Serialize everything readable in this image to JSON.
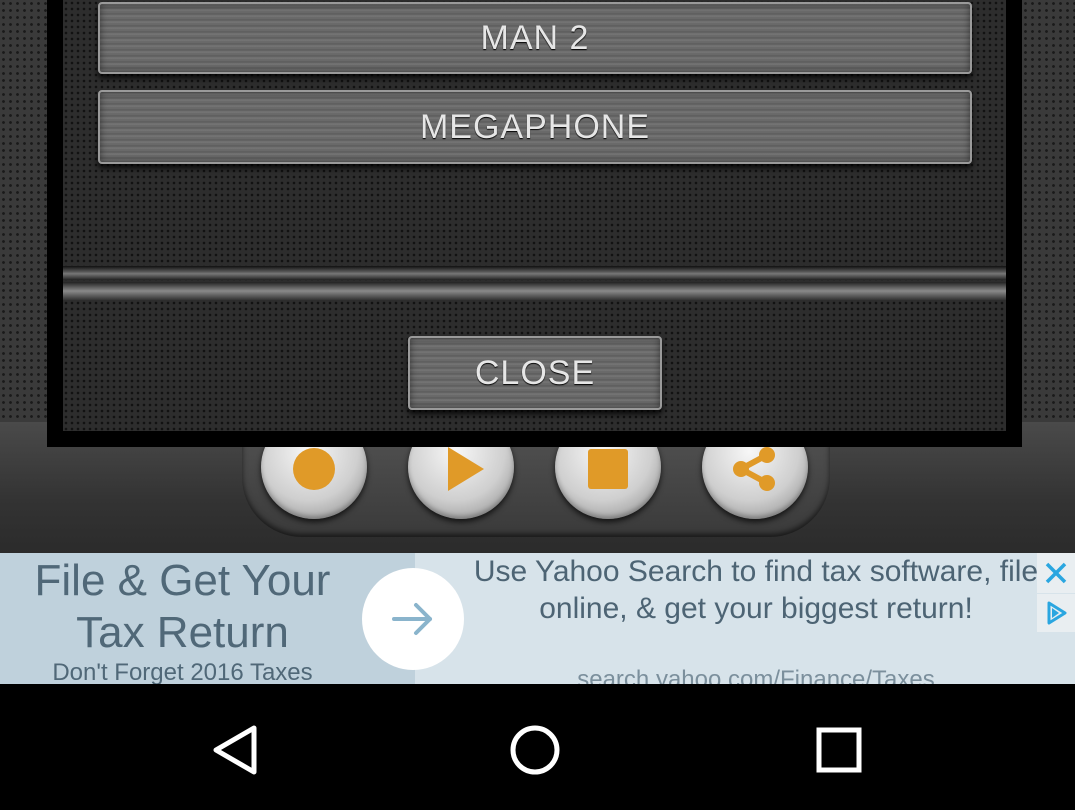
{
  "dialog": {
    "options": [
      {
        "label": "MAN 2"
      },
      {
        "label": "MEGAPHONE"
      }
    ],
    "close_label": "CLOSE"
  },
  "controls": {
    "record": "record-icon",
    "play": "play-icon",
    "stop": "stop-icon",
    "share": "share-icon",
    "accent_color": "#e09a28"
  },
  "ad": {
    "headline": "File & Get Your Tax Return",
    "subline": "Don't Forget 2016 Taxes",
    "body": "Use Yahoo Search to find tax software, file online, & get your biggest return!",
    "url": "search.yahoo.com/Finance/Taxes",
    "close_icon": "close-icon",
    "adchoices_icon": "adchoices-icon",
    "accent_color": "#2aa6e0"
  },
  "navbar": {
    "back": "back-icon",
    "home": "home-icon",
    "recents": "recents-icon"
  }
}
